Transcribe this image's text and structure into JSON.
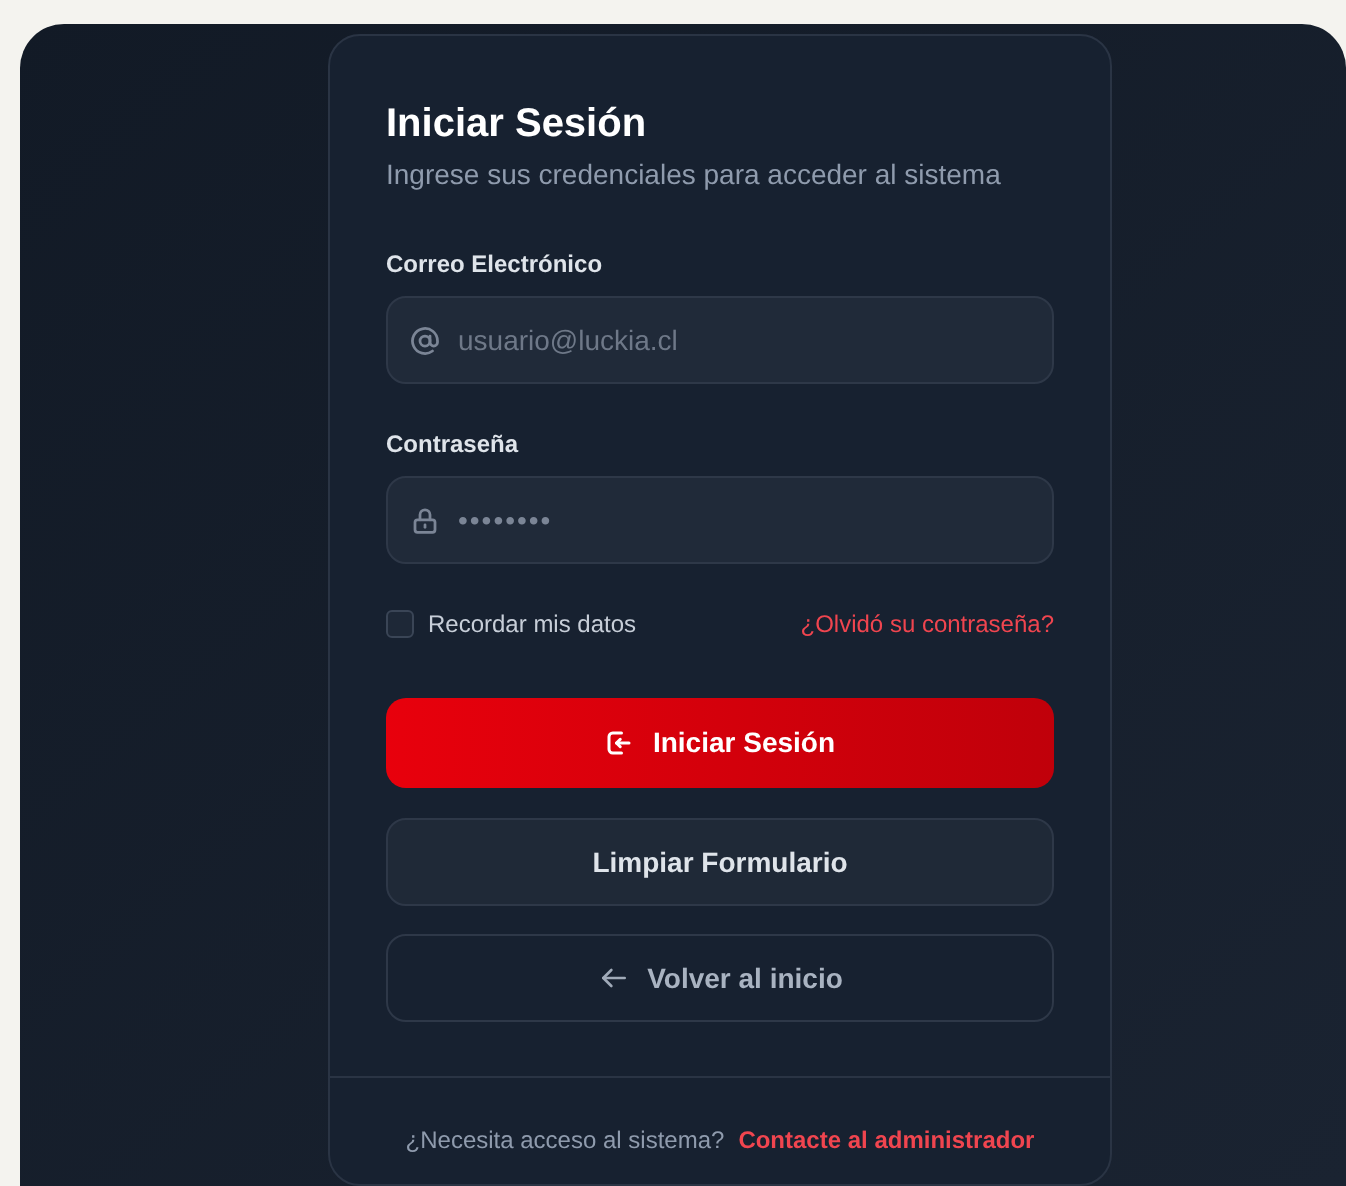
{
  "title": "Iniciar Sesión",
  "subtitle": "Ingrese sus credenciales para acceder al sistema",
  "fields": [
    {
      "label": "Correo Electrónico",
      "placeholder": "usuario@luckia.cl",
      "kind": "email"
    },
    {
      "label": "Contraseña",
      "placeholder": "••••••••",
      "kind": "password"
    }
  ],
  "remember": {
    "label": "Recordar mis datos",
    "checked": false
  },
  "forgot_link": "¿Olvidó su contraseña?",
  "buttons": [
    {
      "label": "Iniciar Sesión",
      "kind": "primary"
    },
    {
      "label": "Limpiar Formulario",
      "kind": "secondary"
    },
    {
      "label": "Volver al inicio",
      "kind": "back"
    }
  ],
  "footer": {
    "text": "¿Necesita acceso al sistema?",
    "link": "Contacte al administrador"
  }
}
